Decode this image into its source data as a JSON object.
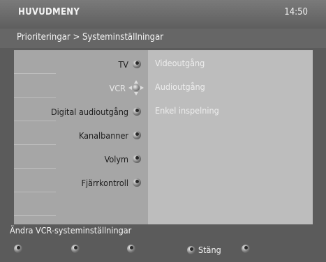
{
  "header": {
    "title": "HUVUDMENY",
    "clock": "14:50"
  },
  "breadcrumb": "Prioriteringar > Systeminställningar",
  "menu": {
    "items": [
      {
        "label": "TV"
      },
      {
        "label": "VCR"
      },
      {
        "label": "Digital audioutgång"
      },
      {
        "label": "Kanalbanner"
      },
      {
        "label": "Volym"
      },
      {
        "label": "Fjärrkontroll"
      }
    ],
    "selected_index": 1
  },
  "submenu": {
    "items": [
      {
        "label": "Videoutgång"
      },
      {
        "label": "Audioutgång"
      },
      {
        "label": "Enkel inspelning"
      }
    ]
  },
  "hint": "Ändra VCR-systeminställningar",
  "footer": {
    "close_label": "Stäng"
  },
  "colors": {
    "background": "#5b5b5b",
    "left_panel": "#a6a6a6",
    "right_panel": "#bdbdbd"
  }
}
